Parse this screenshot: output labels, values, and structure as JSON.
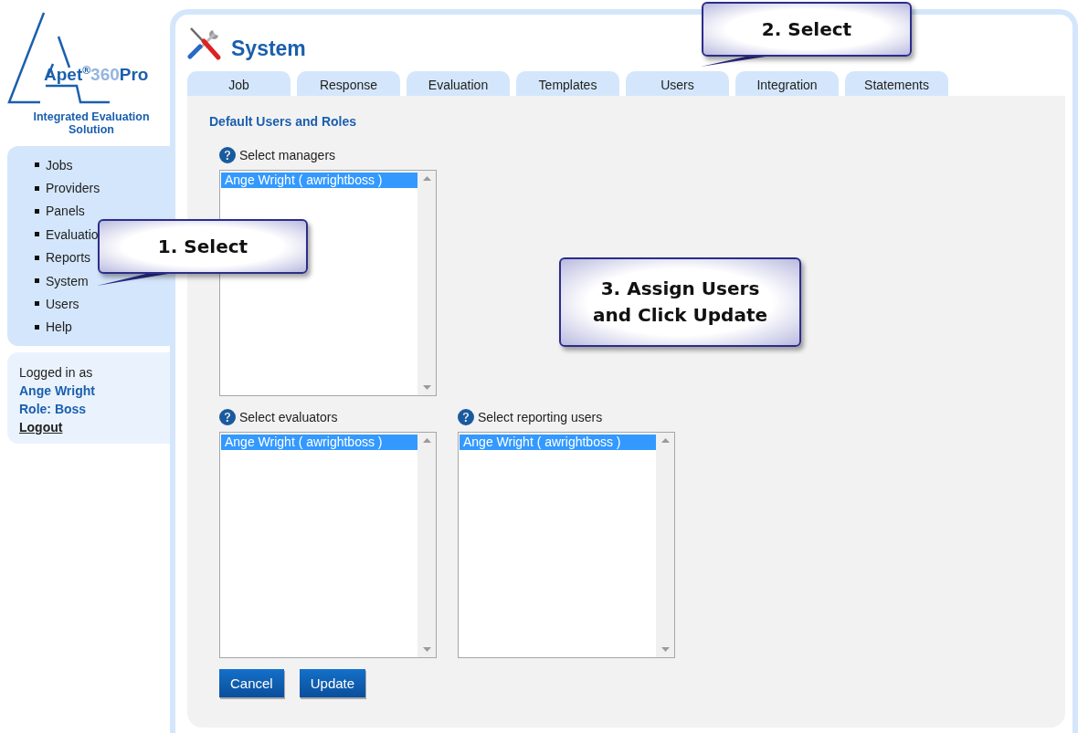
{
  "logo": {
    "text": "**Apet**$^{®}$360**Pro**",
    "tagline": "Integrated Evaluation Solution"
  },
  "nav": {
    "items": [
      {
        "label": "Jobs"
      },
      {
        "label": "Providers"
      },
      {
        "label": "Panels"
      },
      {
        "label": "Evaluatio"
      },
      {
        "label": "Reports"
      },
      {
        "label": "System"
      },
      {
        "label": "Users"
      },
      {
        "label": "Help"
      }
    ]
  },
  "session": {
    "caption": "Logged in as",
    "user": "Ange Wright",
    "role": "Role: Boss",
    "logout": "Logout"
  },
  "page": {
    "title": "System"
  },
  "tabs": [
    {
      "label": "Job"
    },
    {
      "label": "Response"
    },
    {
      "label": "Evaluation"
    },
    {
      "label": "Templates"
    },
    {
      "label": "Users"
    },
    {
      "label": "Integration"
    },
    {
      "label": "Statements"
    }
  ],
  "section": {
    "heading": "Default Users and Roles"
  },
  "lists": [
    {
      "label": "Select managers",
      "options": [
        {
          "text": "Ange Wright ( awrightboss )",
          "selected": true
        }
      ]
    },
    {
      "label": "Select evaluators",
      "options": [
        {
          "text": "Ange Wright ( awrightboss )",
          "selected": true
        }
      ]
    },
    {
      "label": "Select reporting users",
      "options": [
        {
          "text": "Ange Wright ( awrightboss )",
          "selected": true
        }
      ]
    }
  ],
  "buttons": [
    "Cancel",
    "Update"
  ],
  "callouts": [
    {
      "text": "1. Select"
    },
    {
      "text": "2. Select"
    },
    {
      "text": "3. Assign Users and Click Update"
    }
  ]
}
